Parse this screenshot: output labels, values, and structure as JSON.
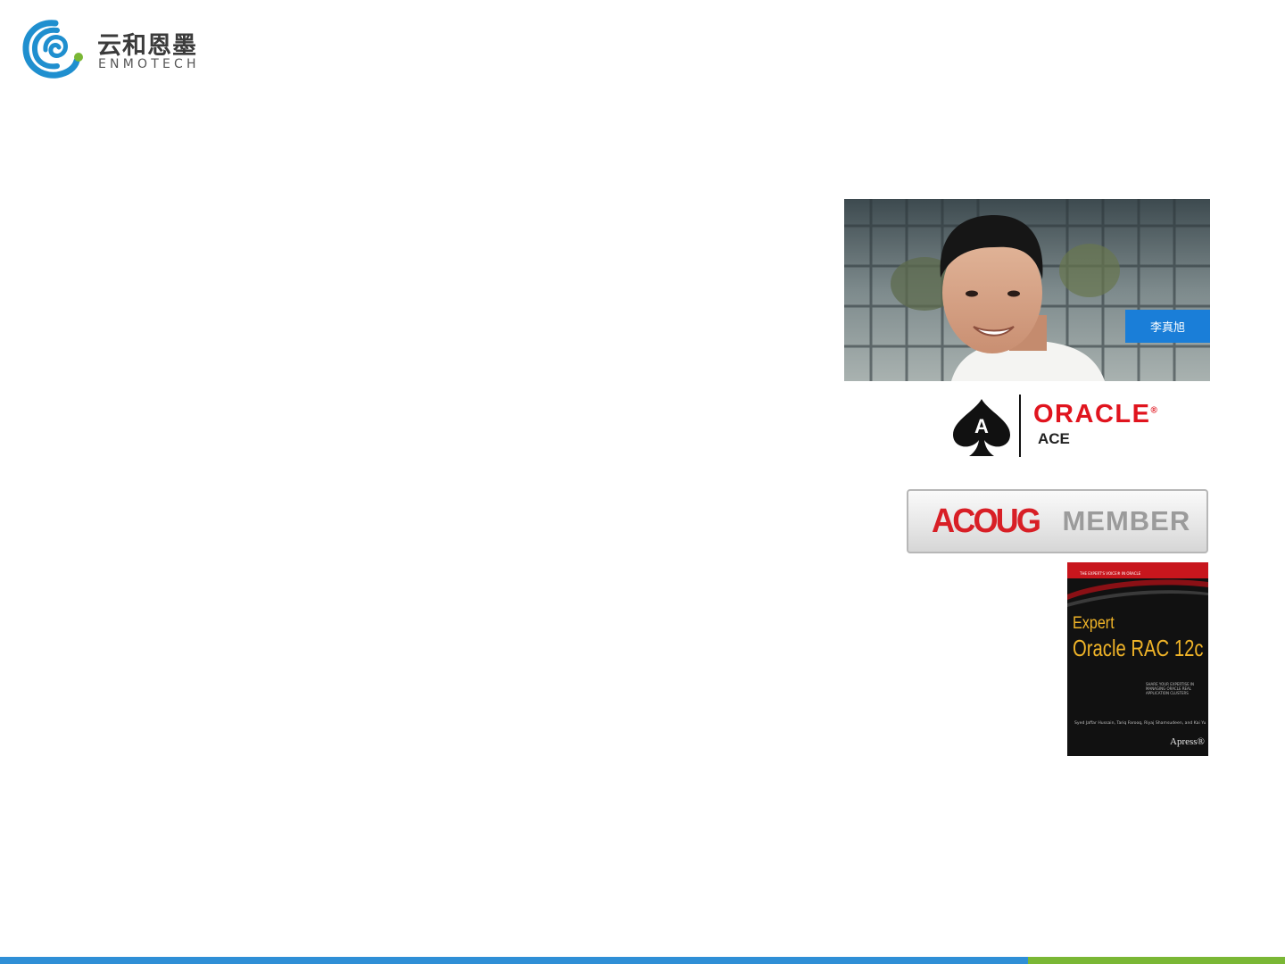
{
  "logo": {
    "name_cn": "云和恩墨",
    "name_en": "ENMOTECH",
    "colors": {
      "swirl": "#1f8fcf",
      "dot": "#7ab735"
    }
  },
  "profile": {
    "name": "李真旭",
    "tag_color": "#1a7ed8"
  },
  "badges": {
    "oracle_ace": {
      "brand": "ORACLE",
      "registered": "®",
      "level": "ACE",
      "spade_letter": "A",
      "brand_color": "#e0141e"
    },
    "acoug": {
      "org": "ACOUG",
      "label": "MEMBER",
      "org_color": "#d81f26"
    }
  },
  "book": {
    "series": "THE EXPERT'S VOICE® IN ORACLE",
    "title_line1": "Expert",
    "title_line2": "Oracle RAC 12c",
    "subtitle": "SHARE YOUR EXPERTISE IN MANAGING ORACLE REAL APPLICATION CLUSTERS",
    "authors": "Syed Jaffar Hussain, Tariq Farooq, Riyaj Shamsudeen, and Kai Yu",
    "publisher": "Apress®",
    "title_color": "#f0b428"
  },
  "footer": {
    "blue": "#2f8fd6",
    "green": "#7ab735",
    "blue_share": 0.8
  }
}
